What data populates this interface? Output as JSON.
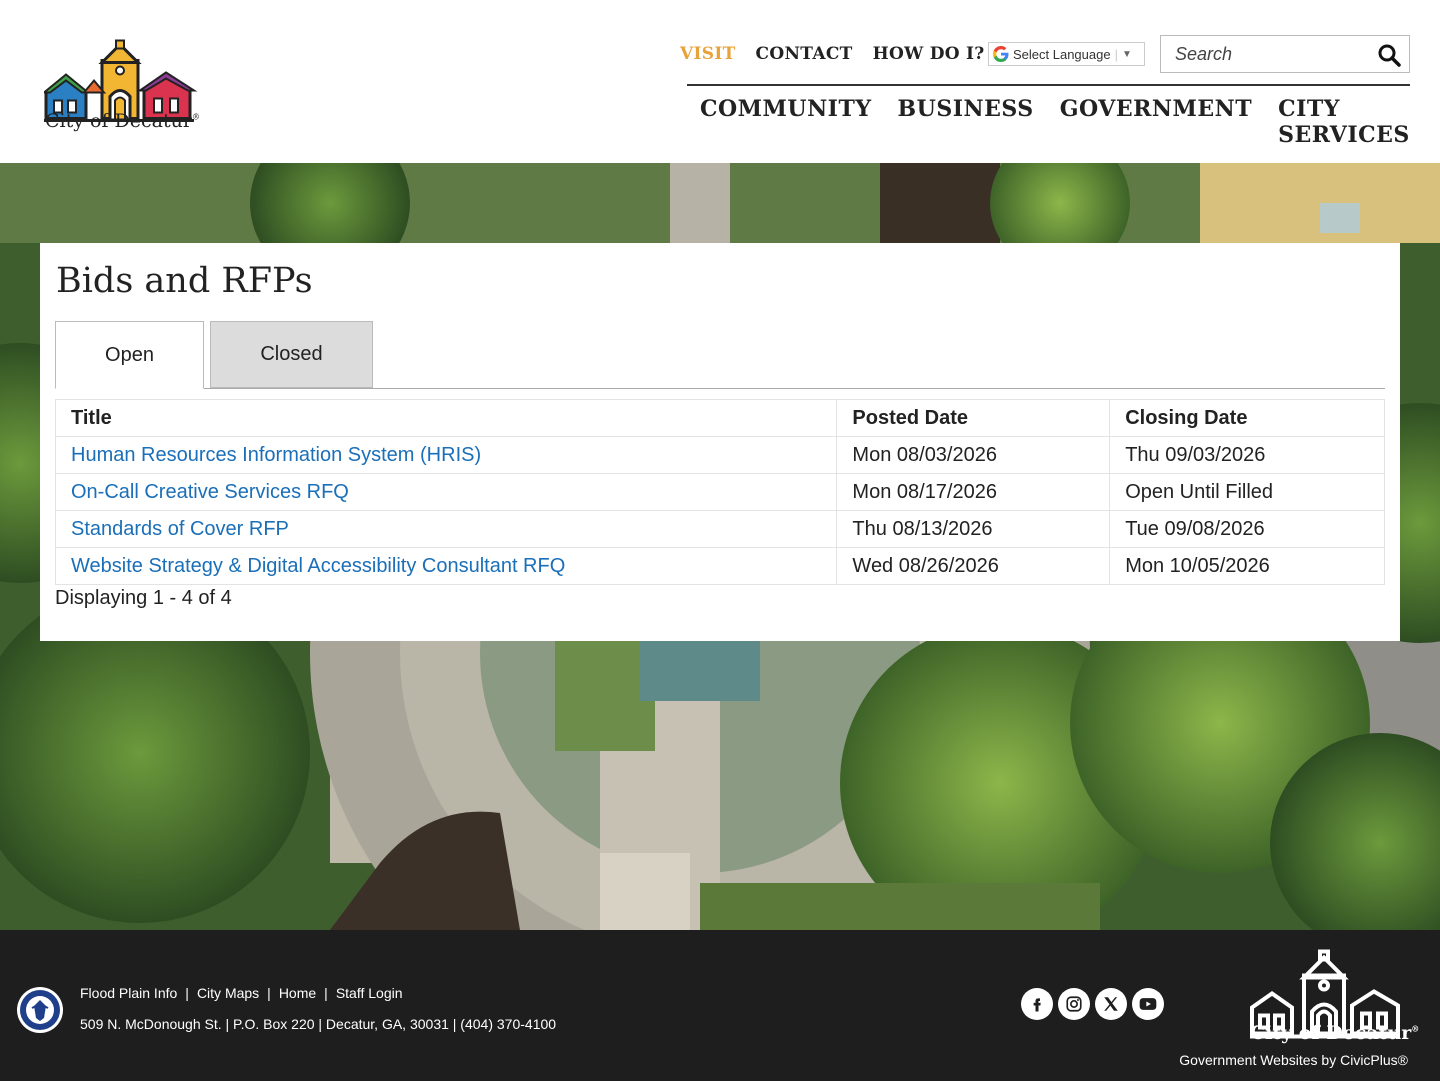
{
  "header": {
    "logo_text": "City of Decatur",
    "utility_nav": [
      "VISIT",
      "CONTACT",
      "HOW DO I?"
    ],
    "language_label": "Select Language",
    "search_placeholder": "Search",
    "main_nav": [
      "COMMUNITY",
      "BUSINESS",
      "GOVERNMENT",
      "CITY SERVICES"
    ]
  },
  "main": {
    "title": "Bids and RFPs",
    "tabs": [
      {
        "label": "Open",
        "active": true
      },
      {
        "label": "Closed",
        "active": false
      }
    ],
    "table": {
      "headers": [
        "Title",
        "Posted Date",
        "Closing Date"
      ],
      "rows": [
        {
          "title": "Human Resources Information System (HRIS)",
          "posted": "Mon 08/03/2026",
          "closing": "Thu 09/03/2026"
        },
        {
          "title": "On-Call Creative Services RFQ",
          "posted": "Mon 08/17/2026",
          "closing": "Open Until Filled"
        },
        {
          "title": "Standards of Cover RFP",
          "posted": "Thu 08/13/2026",
          "closing": "Tue 09/08/2026"
        },
        {
          "title": "Website Strategy & Digital Accessibility Consultant RFQ",
          "posted": "Wed 08/26/2026",
          "closing": "Mon 10/05/2026"
        }
      ]
    },
    "display_count": "Displaying 1 - 4 of 4"
  },
  "footer": {
    "links": [
      "Flood Plain Info",
      "City Maps",
      "Home",
      "Staff Login"
    ],
    "address": "509 N. McDonough St. | P.O. Box 220 | Decatur, GA, 30031 | (404) 370-4100",
    "social_icons": [
      "facebook-icon",
      "instagram-icon",
      "x-icon",
      "youtube-icon"
    ],
    "logo_text": "City of Decatur",
    "credit": "Government Websites by CivicPlus®"
  },
  "colors": {
    "link": "#1a6fb8",
    "visit_accent": "#e8a23a",
    "footer_bg": "#1e1e1e",
    "tab_inactive_bg": "#dcdcdc"
  }
}
